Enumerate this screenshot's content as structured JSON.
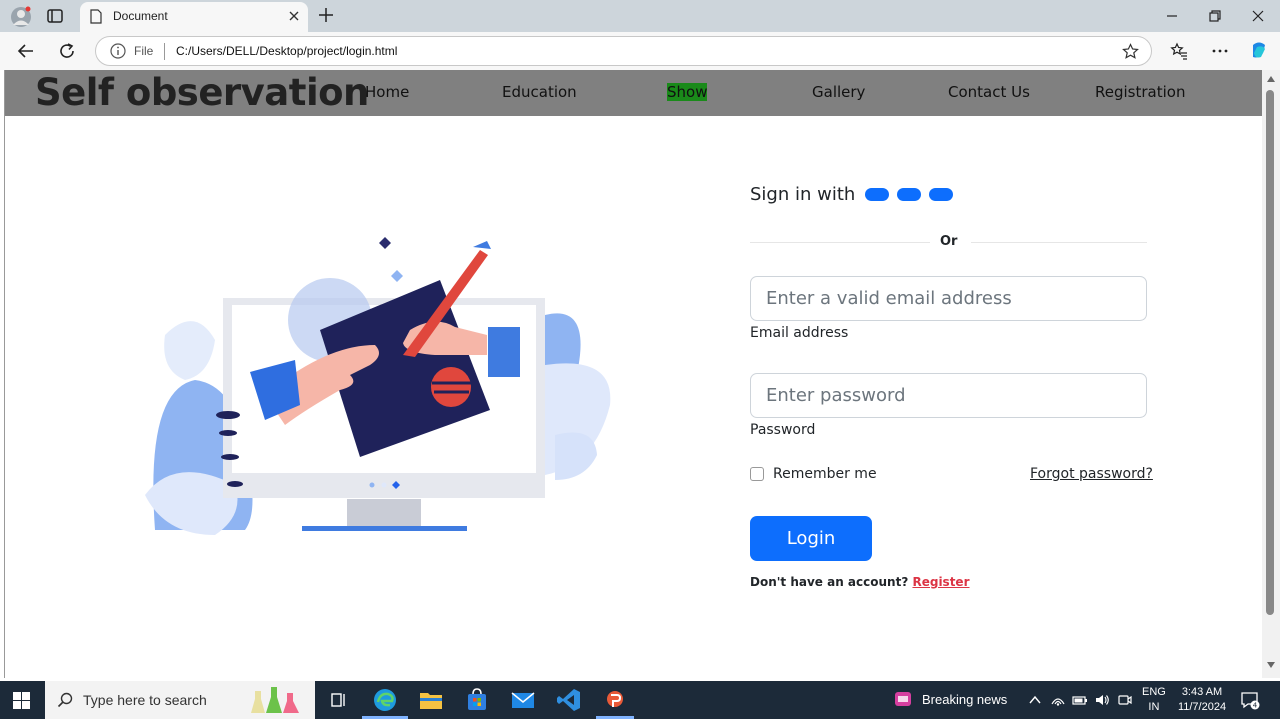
{
  "browser": {
    "tab_title": "Document",
    "address_scheme_label": "File",
    "url": "C:/Users/DELL/Desktop/project/login.html"
  },
  "site": {
    "title": "Self observation",
    "nav": [
      {
        "label": "Home"
      },
      {
        "label": "Education"
      },
      {
        "label": "Show",
        "active": true,
        "highlight_color": "#1a8a1a"
      },
      {
        "label": "Gallery"
      },
      {
        "label": "Contact Us"
      },
      {
        "label": "Registration"
      }
    ]
  },
  "form": {
    "signin_label": "Sign in with",
    "social_buttons": 3,
    "or_text": "Or",
    "email": {
      "placeholder": "Enter a valid email address",
      "label": "Email address"
    },
    "password": {
      "placeholder": "Enter password",
      "label": "Password"
    },
    "remember_label": "Remember me",
    "forgot_label": "Forgot password?",
    "login_label": "Login",
    "no_account_text": "Don't have an account? ",
    "register_label": "Register"
  },
  "taskbar": {
    "search_placeholder": "Type here to search",
    "news_text": "Breaking news",
    "lang_top": "ENG",
    "lang_bottom": "IN",
    "time": "3:43 AM",
    "date": "11/7/2024",
    "notification_count": "4"
  },
  "colors": {
    "primary": "#0d6efd",
    "header_bg": "#808080",
    "register_link": "#dc3545",
    "taskbar_bg": "#1c2a39"
  }
}
